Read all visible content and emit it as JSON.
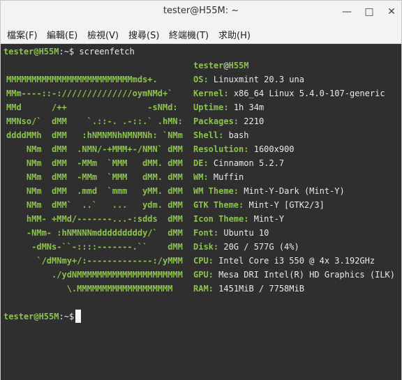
{
  "window": {
    "title": "tester@H55M: ~",
    "controls": {
      "minimize": "—",
      "maximize": "□",
      "close": "✕"
    }
  },
  "menu": [
    "檔案(F)",
    "編輯(E)",
    "檢視(V)",
    "搜尋(S)",
    "終端機(T)",
    "求助(H)"
  ],
  "terminal": {
    "prompt1": {
      "user": "tester@H55M",
      "path": ":~$ ",
      "command": "screenfetch"
    },
    "logo": [
      "MMMMMMMMMMMMMMMMMMMMMMMMMmds+.",
      "MMm----::-://////////////oymNMd+`",
      "MMd      /++                -sNMd:",
      "MMNso/`  dMM    `.::-. .-::.` .hMN:",
      "ddddMMh  dMM   :hNMNMNhNMNMNh: `NMm",
      "    NMm  dMM  .NMN/-+MMM+-/NMN` dMM",
      "    NMm  dMM  -MMm  `MMM   dMM. dMM",
      "    NMm  dMM  -MMm  `MMM   dMM. dMM",
      "    NMm  dMM  .mmd  `mmm   yMM. dMM",
      "    NMm  dMM`  ..`   ...   ydm. dMM",
      "    hMM- +MMd/-------...-:sdds  dMM",
      "    -NMm- :hNMNNNmdddddddddy/`  dMM",
      "     -dMNs-``-::::-------.``    dMM",
      "      `/dMNmy+/:-------------:/yMMM",
      "         ./ydNMMMMMMMMMMMMMMMMMMMMM",
      "            \\.MMMMMMMMMMMMMMMMMMM"
    ],
    "userhost": {
      "user": "tester",
      "at": "@",
      "host": "H55M"
    },
    "info": [
      {
        "label": "OS:",
        "value": "Linuxmint 20.3 una"
      },
      {
        "label": "Kernel:",
        "value": "x86_64 Linux 5.4.0-107-generic"
      },
      {
        "label": "Uptime:",
        "value": "1h 34m"
      },
      {
        "label": "Packages:",
        "value": "2210"
      },
      {
        "label": "Shell:",
        "value": "bash"
      },
      {
        "label": "Resolution:",
        "value": "1600x900"
      },
      {
        "label": "DE:",
        "value": "Cinnamon 5.2.7"
      },
      {
        "label": "WM:",
        "value": "Muffin"
      },
      {
        "label": "WM Theme:",
        "value": "Mint-Y-Dark (Mint-Y)"
      },
      {
        "label": "GTK Theme:",
        "value": "Mint-Y [GTK2/3]"
      },
      {
        "label": "Icon Theme:",
        "value": "Mint-Y"
      },
      {
        "label": "Font:",
        "value": "Ubuntu 10"
      },
      {
        "label": "Disk:",
        "value": "20G / 577G (4%)"
      },
      {
        "label": "CPU:",
        "value": "Intel Core i3 550 @ 4x 3.192GHz"
      },
      {
        "label": "GPU:",
        "value": "Mesa DRI Intel(R) HD Graphics (ILK)"
      },
      {
        "label": "RAM:",
        "value": "1451MiB / 7758MiB"
      }
    ],
    "prompt2": {
      "user": "tester@H55M",
      "path": ":~$ "
    }
  },
  "colors": {
    "accent": "#8bc34a",
    "background": "#2f2f2f",
    "text": "#e9e9e9"
  }
}
